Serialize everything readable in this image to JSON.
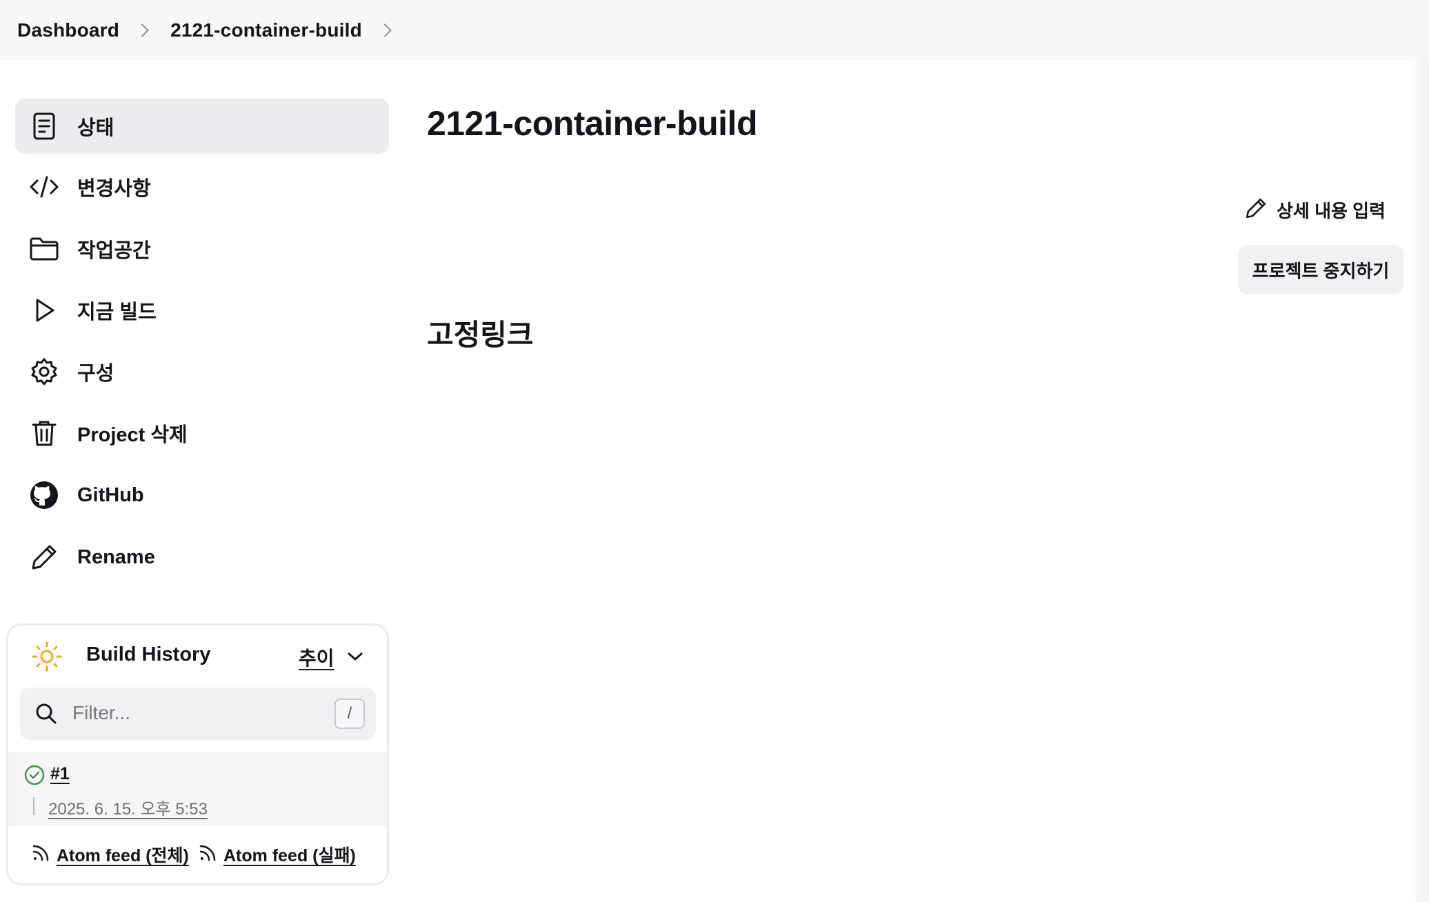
{
  "breadcrumb": {
    "items": [
      "Dashboard",
      "2121-container-build"
    ]
  },
  "sidebar": {
    "items": [
      {
        "label": "상태",
        "icon": "document-icon",
        "active": true
      },
      {
        "label": "변경사항",
        "icon": "code-icon"
      },
      {
        "label": "작업공간",
        "icon": "folder-icon"
      },
      {
        "label": "지금 빌드",
        "icon": "play-icon"
      },
      {
        "label": "구성",
        "icon": "gear-icon"
      },
      {
        "label": "Project 삭제",
        "icon": "trash-icon"
      },
      {
        "label": "GitHub",
        "icon": "github-icon"
      },
      {
        "label": "Rename",
        "icon": "pencil-icon"
      }
    ]
  },
  "build_history": {
    "title": "Build History",
    "trend_label": "추이",
    "filter_placeholder": "Filter...",
    "shortcut_key": "/",
    "builds": [
      {
        "number": "#1",
        "time": "2025. 6. 15. 오후 5:53",
        "status": "success"
      }
    ],
    "feeds": [
      "Atom feed (전체)",
      "Atom feed (실패)"
    ]
  },
  "main": {
    "title": "2121-container-build",
    "edit_description": "상세 내용 입력",
    "disable_project": "프로젝트 중지하기",
    "permalinks_heading": "고정링크"
  },
  "colors": {
    "text": "#14141f",
    "active_bg": "#ececf0",
    "success": "#3d9a48",
    "weather_sun": "#f5a623"
  }
}
